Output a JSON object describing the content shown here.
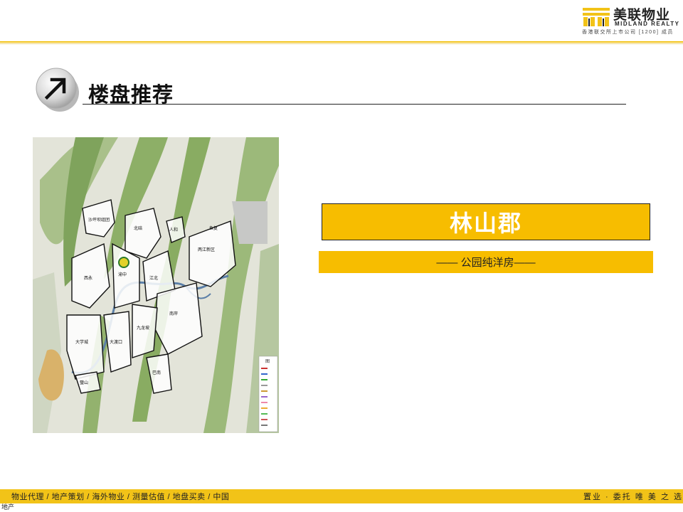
{
  "header": {
    "logo_cn": "美联物业",
    "logo_en": "MIDLAND REALTY",
    "logo_subtitle": "香港联交所上市公司 [1200] 成员"
  },
  "section": {
    "title": "楼盘推荐",
    "badge_icon": "arrow-up-right-icon"
  },
  "property": {
    "name": "林山郡",
    "tagline": "—— 公园纯洋房——"
  },
  "map": {
    "legend_title": "图",
    "district_labels": [
      "沙坪坝组团",
      "九龙坡",
      "渝中",
      "江北",
      "南岸",
      "大渡口",
      "巴南",
      "璧山",
      "北碚",
      "两江新区",
      "鱼复",
      "人和",
      "西永",
      "大学城"
    ]
  },
  "footer": {
    "nav": "物业代理 /  地产策划 /  海外物业  /  测量估值  /  地盘买卖  /  中国",
    "slogan": "置业 · 委托  唯  美  之  选"
  },
  "corner_text": "地产",
  "colors": {
    "accent_yellow": "#f7bd00",
    "header_line": "#f2c318",
    "text_dark": "#111111"
  }
}
